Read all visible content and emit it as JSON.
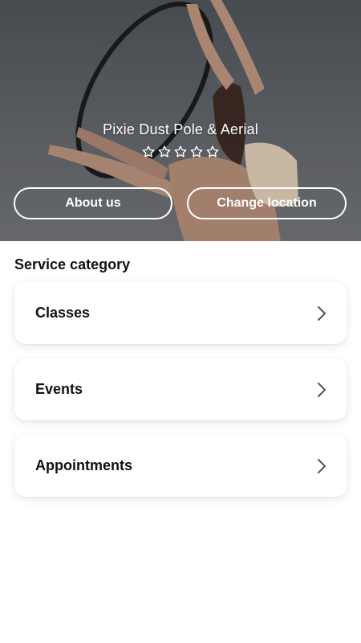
{
  "hero": {
    "studio_name": "Pixie Dust Pole & Aerial",
    "rating": {
      "value": 0,
      "max": 5
    },
    "background_image": "aerial hoop performer photo",
    "buttons": {
      "about_label": "About us",
      "location_label": "Change location"
    }
  },
  "service": {
    "title": "Service category",
    "items": [
      {
        "label": "Classes",
        "icon": "chevron-right-icon"
      },
      {
        "label": "Events",
        "icon": "chevron-right-icon"
      },
      {
        "label": "Appointments",
        "icon": "chevron-right-icon"
      }
    ]
  },
  "colors": {
    "background": "#ffffff",
    "text": "#111111",
    "hero_text": "#ffffff",
    "chevron": "#555555"
  }
}
